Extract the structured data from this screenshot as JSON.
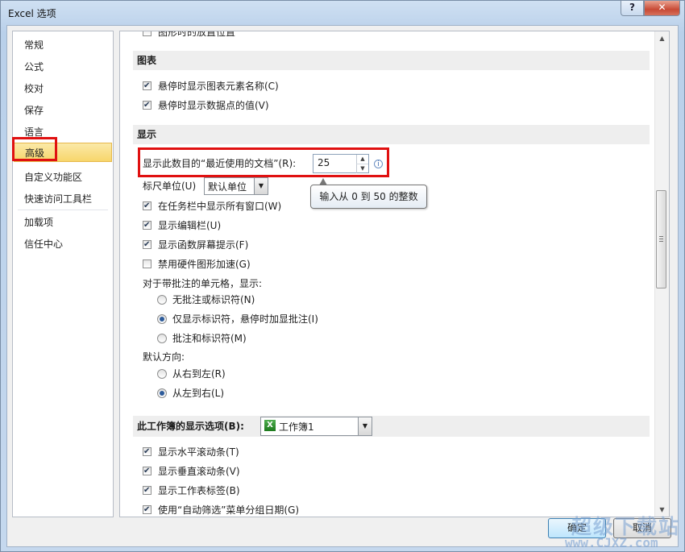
{
  "window": {
    "title": "Excel 选项",
    "help": "?",
    "close": "✕"
  },
  "nav": {
    "items": [
      {
        "label": "常规"
      },
      {
        "label": "公式"
      },
      {
        "label": "校对"
      },
      {
        "label": "保存"
      },
      {
        "label": "语言"
      },
      {
        "label": "高级"
      },
      {
        "label": "自定义功能区"
      },
      {
        "label": "快速访问工具栏"
      },
      {
        "label": "加载项"
      },
      {
        "label": "信任中心"
      }
    ],
    "selected": "高级"
  },
  "content": {
    "partial_top": "图形时的放置位置",
    "chart_section": {
      "title": "图表",
      "items": [
        {
          "label": "悬停时显示图表元素名称(C)",
          "checked": true
        },
        {
          "label": "悬停时显示数据点的值(V)",
          "checked": true
        }
      ]
    },
    "display_section": {
      "title": "显示",
      "recent_docs_label": "显示此数目的“最近使用的文档”(R):",
      "recent_docs_value": "25",
      "tooltip": "输入从 0 到 50 的整数",
      "ruler_label": "标尺单位(U)",
      "ruler_value": "默认单位",
      "items": [
        {
          "label": "在任务栏中显示所有窗口(W)",
          "checked": true
        },
        {
          "label": "显示编辑栏(U)",
          "checked": true
        },
        {
          "label": "显示函数屏幕提示(F)",
          "checked": true
        },
        {
          "label": "禁用硬件图形加速(G)",
          "checked": false
        }
      ],
      "comments_label": "对于带批注的单元格，显示:",
      "comments_options": [
        {
          "label": "无批注或标识符(N)",
          "checked": false
        },
        {
          "label": "仅显示标识符，悬停时加显批注(I)",
          "checked": true
        },
        {
          "label": "批注和标识符(M)",
          "checked": false
        }
      ],
      "direction_label": "默认方向:",
      "direction_options": [
        {
          "label": "从右到左(R)",
          "checked": false
        },
        {
          "label": "从左到右(L)",
          "checked": true
        }
      ]
    },
    "workbook_section": {
      "title": "此工作簿的显示选项(B):",
      "workbook_value": "工作簿1",
      "items": [
        {
          "label": "显示水平滚动条(T)",
          "checked": true
        },
        {
          "label": "显示垂直滚动条(V)",
          "checked": true
        },
        {
          "label": "显示工作表标签(B)",
          "checked": true
        },
        {
          "label": "使用“自动筛选”菜单分组日期(G)",
          "checked": true
        }
      ]
    }
  },
  "buttons": {
    "ok": "确定",
    "cancel": "取消"
  },
  "watermark": {
    "big": "超级下载站",
    "small": "www.CJXZ.com"
  },
  "colors": {
    "highlight_box": "#e01010",
    "selected_nav": "#f7d66b"
  },
  "icons": {
    "excel": "excel-workbook-icon",
    "info": "info-icon"
  }
}
